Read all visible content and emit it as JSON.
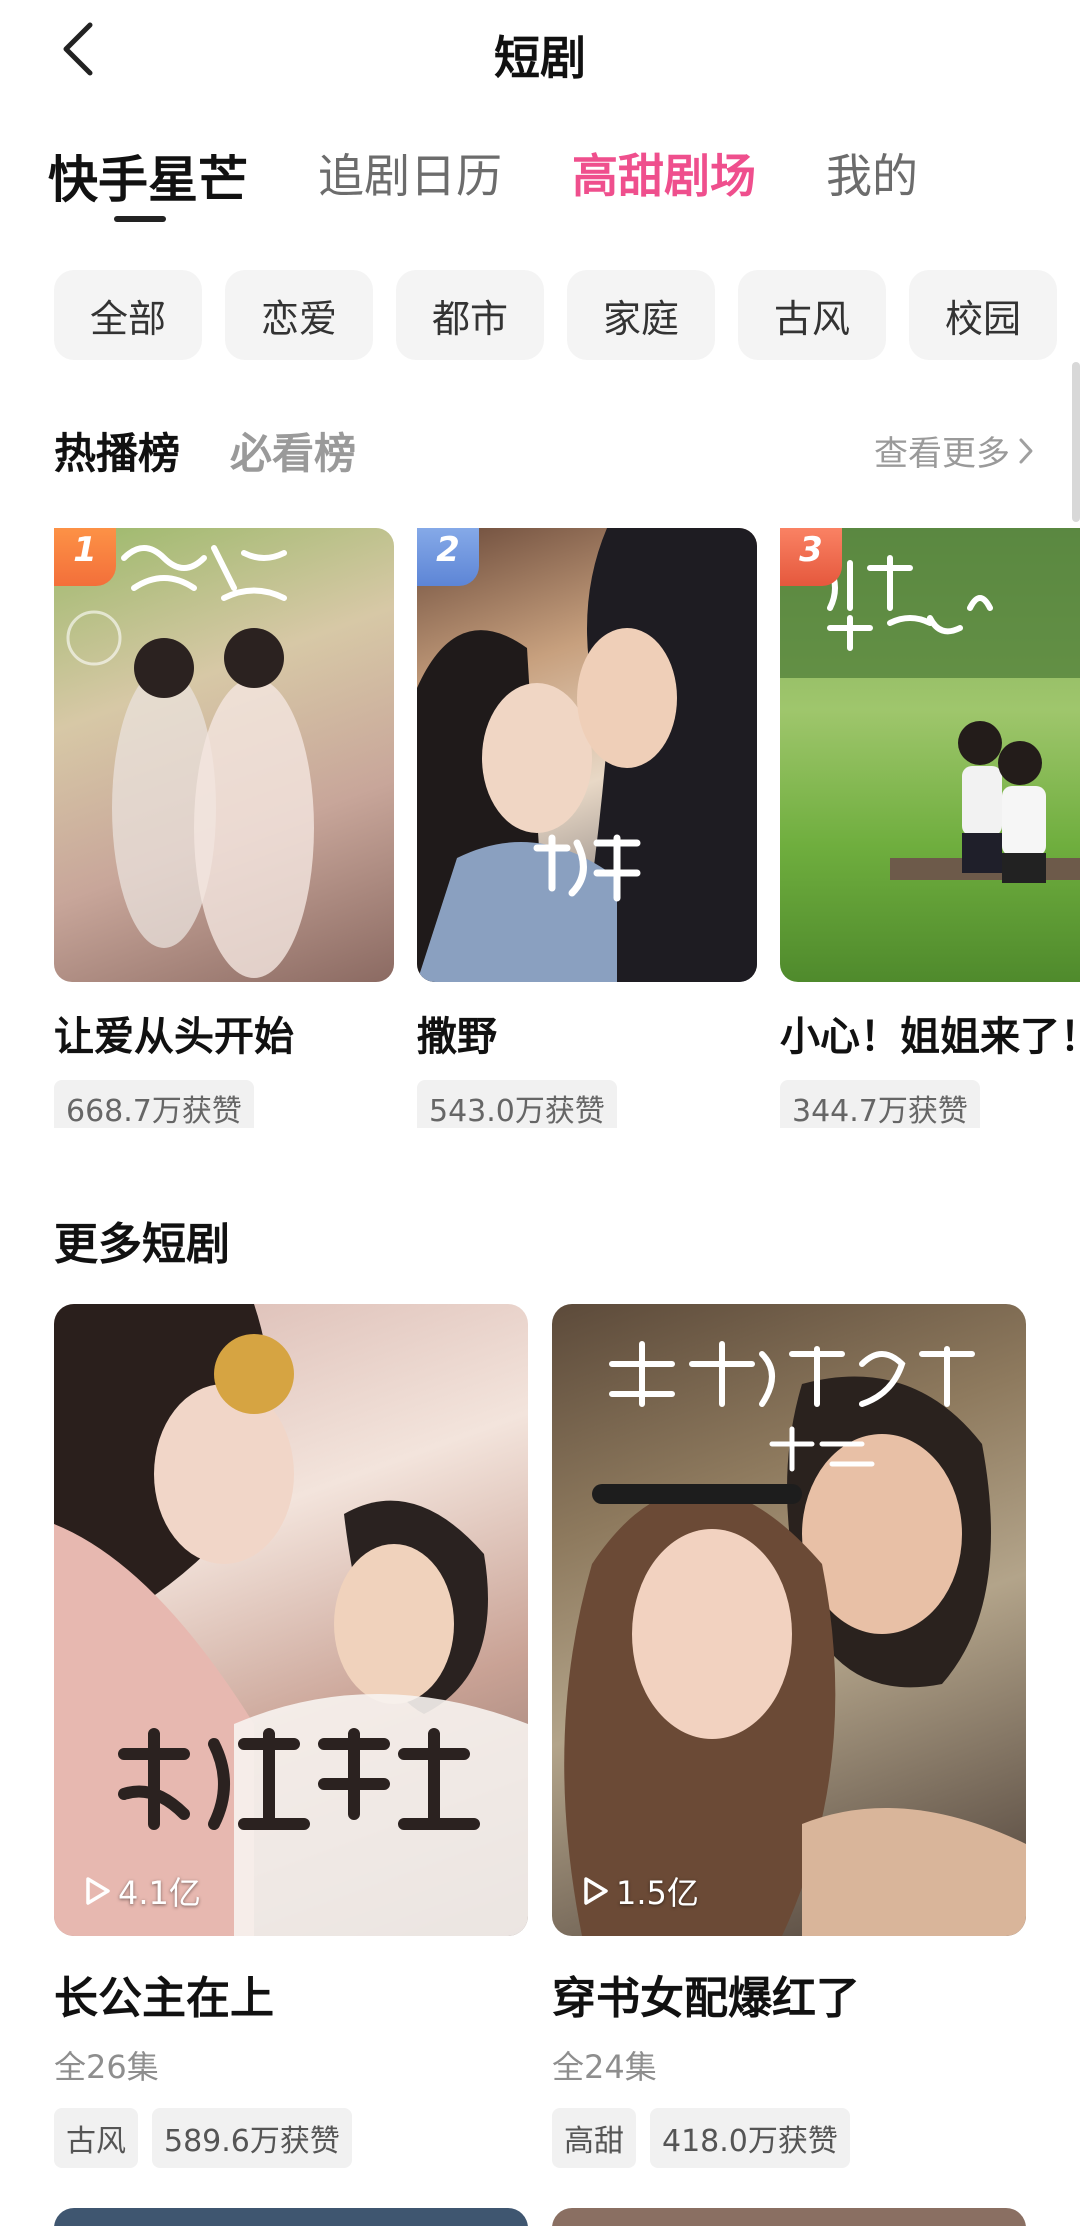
{
  "header": {
    "title": "短剧",
    "back_icon": "chevron-left-icon"
  },
  "tabs": [
    {
      "label": "快手星芒",
      "active": true
    },
    {
      "label": "追剧日历",
      "active": false
    },
    {
      "label": "高甜剧场",
      "active": false,
      "highlight_color": "#ef4f8d"
    },
    {
      "label": "我的",
      "active": false
    }
  ],
  "categories": [
    "全部",
    "恋爱",
    "都市",
    "家庭",
    "古风",
    "校园"
  ],
  "ranking": {
    "tabs": [
      {
        "label": "热播榜",
        "active": true
      },
      {
        "label": "必看榜",
        "active": false
      }
    ],
    "see_more": "查看更多",
    "items": [
      {
        "rank": "1",
        "title": "让爱从头开始",
        "likes": "668.7万获赞"
      },
      {
        "rank": "2",
        "title": "撒野",
        "likes": "543.0万获赞"
      },
      {
        "rank": "3",
        "title": "小心！姐姐来了！",
        "likes": "344.7万获赞"
      }
    ]
  },
  "more": {
    "title": "更多短剧",
    "items": [
      {
        "title": "长公主在上",
        "plays": "4.1亿",
        "episodes": "全26集",
        "genre": "古风",
        "likes": "589.6万获赞"
      },
      {
        "title": "穿书女配爆红了",
        "plays": "1.5亿",
        "episodes": "全24集",
        "genre": "高甜",
        "likes": "418.0万获赞"
      }
    ]
  },
  "colors": {
    "accent_pink": "#ef4f8d",
    "rank1": "#f47a3d",
    "rank2": "#6b8fd9",
    "rank3": "#ea6244"
  }
}
